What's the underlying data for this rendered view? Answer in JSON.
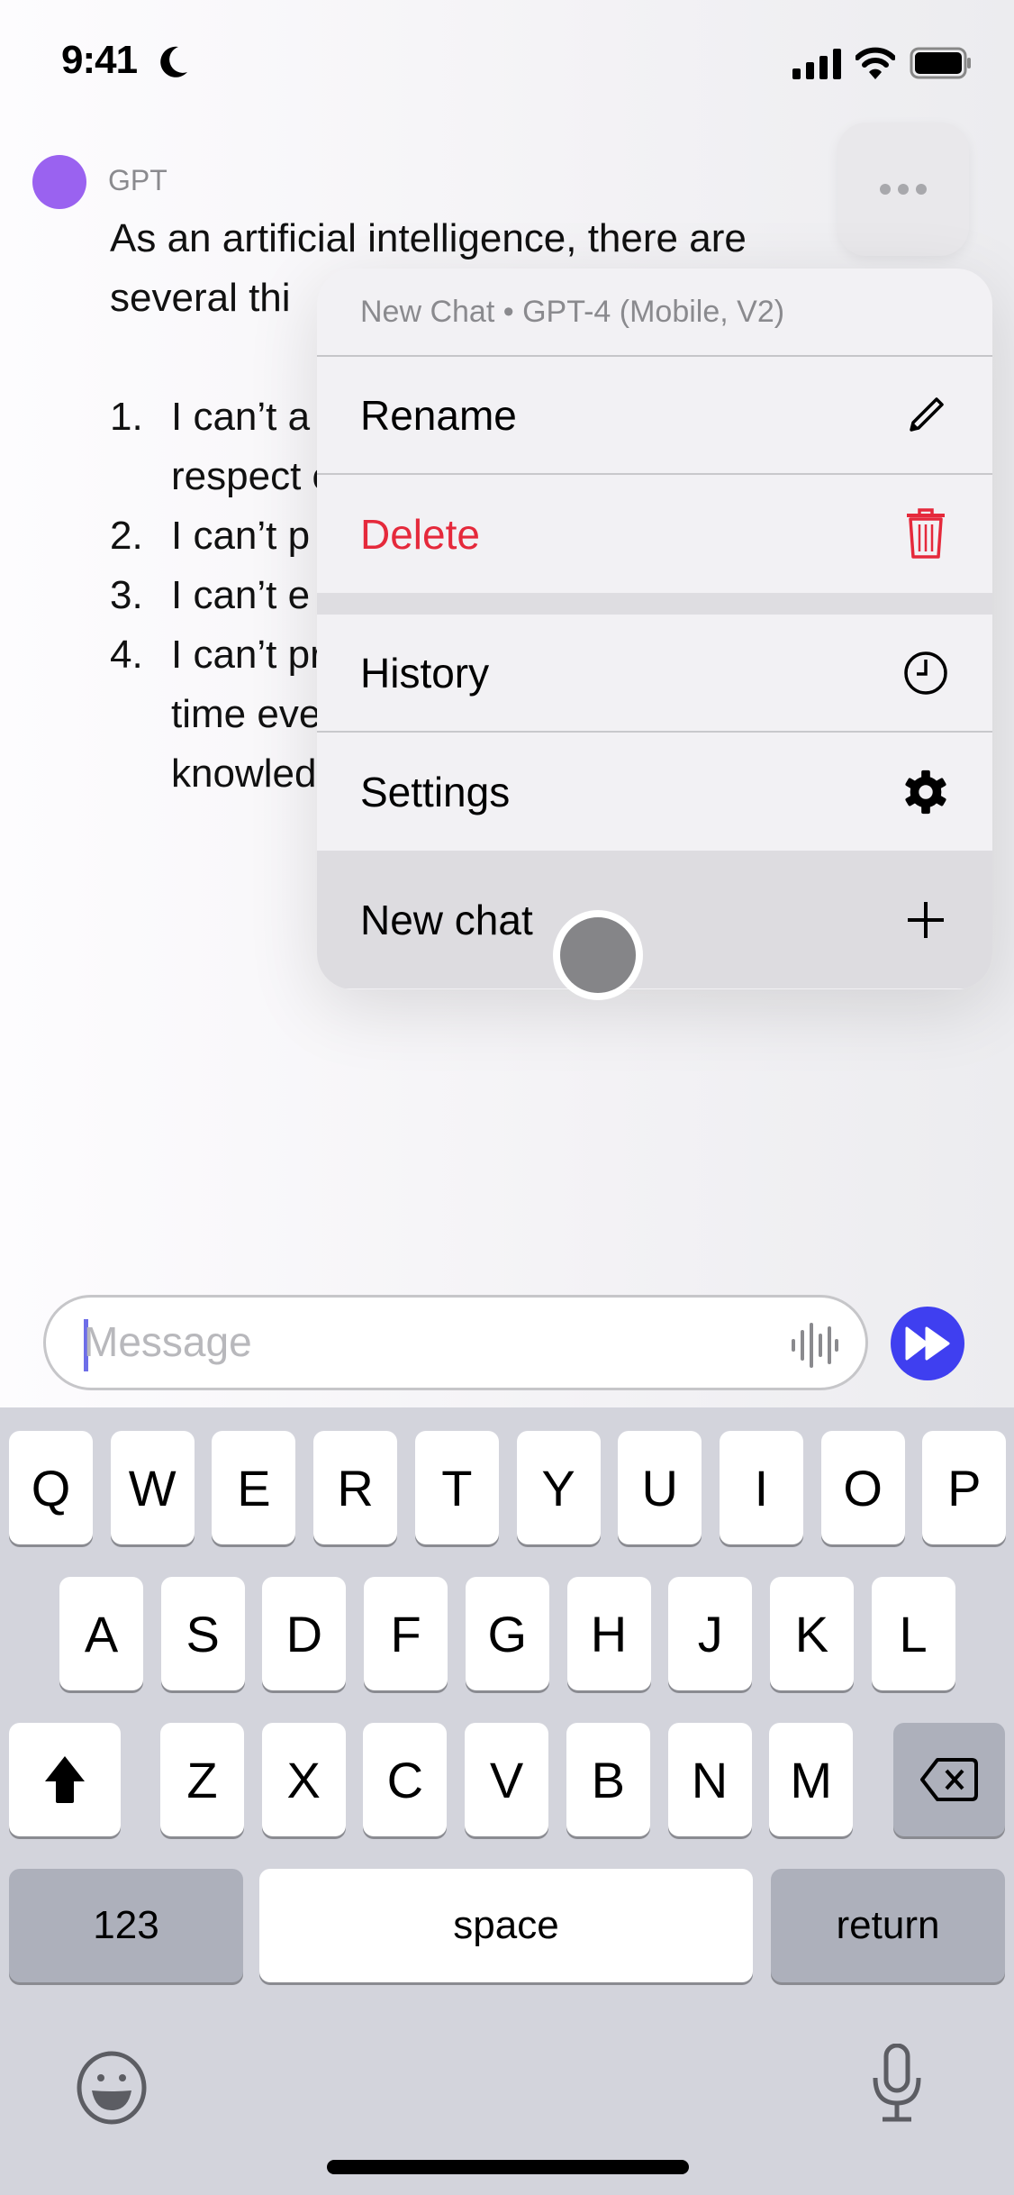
{
  "status_bar": {
    "time": "9:41"
  },
  "message": {
    "sender": "GPT",
    "intro": "As an artificial intelligence, there are\nseveral thi",
    "items": [
      {
        "num": "1.",
        "text": "I can’t a individu with me convers respect confide"
      },
      {
        "num": "2.",
        "text": "I can’t p don’t h"
      },
      {
        "num": "3.",
        "text": "I can’t e persona have consciousness."
      },
      {
        "num": "4.",
        "text": "I can’t predict the future or know real-time events. My training only includes knowledge up until September 2021."
      }
    ]
  },
  "menu": {
    "header": "New Chat • GPT-4 (Mobile, V2)",
    "items": [
      {
        "label": "Rename",
        "icon": "pencil-icon"
      },
      {
        "label": "Delete",
        "icon": "trash-icon"
      },
      {
        "label": "History",
        "icon": "clock-icon"
      },
      {
        "label": "Settings",
        "icon": "gear-icon"
      },
      {
        "label": "New chat",
        "icon": "plus-icon"
      }
    ]
  },
  "composer": {
    "placeholder": "Message"
  },
  "keyboard": {
    "row1": [
      "Q",
      "W",
      "E",
      "R",
      "T",
      "Y",
      "U",
      "I",
      "O",
      "P"
    ],
    "row2": [
      "A",
      "S",
      "D",
      "F",
      "G",
      "H",
      "J",
      "K",
      "L"
    ],
    "row3": [
      "Z",
      "X",
      "C",
      "V",
      "B",
      "N",
      "M"
    ],
    "numbers_label": "123",
    "space_label": "space",
    "return_label": "return"
  },
  "colors": {
    "accent": "#3f3ff0",
    "avatar": "#9a62f0",
    "danger": "#e5293b"
  }
}
